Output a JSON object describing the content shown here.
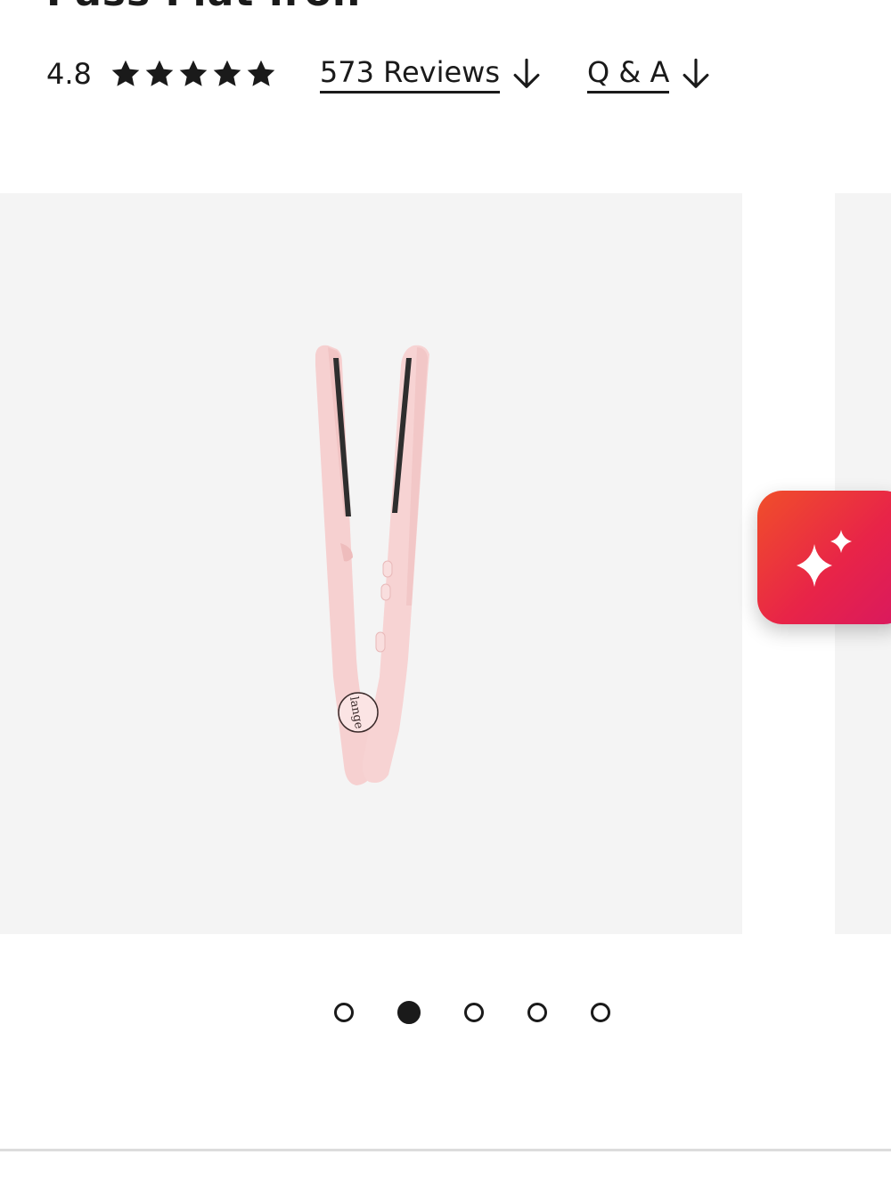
{
  "product": {
    "title": "Pass Flat Iron"
  },
  "rating": {
    "value": "4.8",
    "stars": 5,
    "star_icon": "star-filled-icon"
  },
  "links": {
    "reviews_label": "573 Reviews",
    "qa_label": "Q & A",
    "arrow_icon": "arrow-down-icon"
  },
  "gallery": {
    "product_alt": "pink flat iron",
    "logo_text": "lange",
    "slide_count": 5,
    "active_slide": 2
  },
  "ai_button": {
    "icon": "sparkle-icon"
  },
  "colors": {
    "accent_start": "#f04f2a",
    "accent_end": "#d81860",
    "product_pink": "#f7d3d3",
    "image_bg": "#f4f4f4"
  }
}
